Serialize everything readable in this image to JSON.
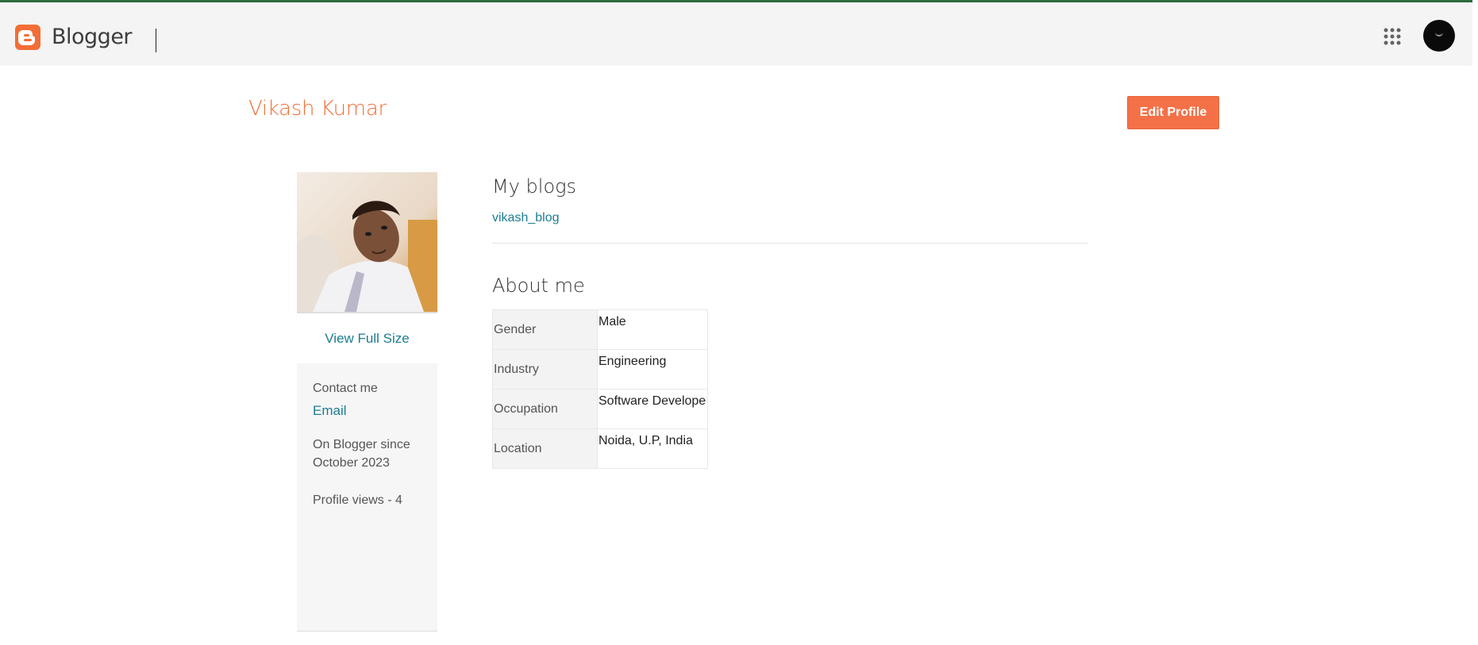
{
  "header": {
    "app_name": "Blogger",
    "icons": [
      "blogger-logo-icon",
      "apps-grid-icon",
      "account-avatar"
    ]
  },
  "profile": {
    "name": "Vikash Kumar",
    "edit_button": "Edit Profile",
    "view_full_size": "View Full Size"
  },
  "sidebar": {
    "contact_label": "Contact me",
    "email_link": "Email",
    "since_line1": "On Blogger since",
    "since_line2": "October 2023",
    "views": "Profile views - 4"
  },
  "blogs": {
    "title": "My blogs",
    "items": [
      "vikash_blog"
    ]
  },
  "about": {
    "title": "About me",
    "rows": [
      {
        "key": "Gender",
        "value": "Male"
      },
      {
        "key": "Industry",
        "value": "Engineering"
      },
      {
        "key": "Occupation",
        "value": "Software Develope"
      },
      {
        "key": "Location",
        "value": "Noida, U.P, India"
      }
    ]
  },
  "colors": {
    "brand": "#f36e36",
    "link": "#1c7d93",
    "header_bg": "#f4f4f4",
    "top_border": "#2d6a3e"
  }
}
